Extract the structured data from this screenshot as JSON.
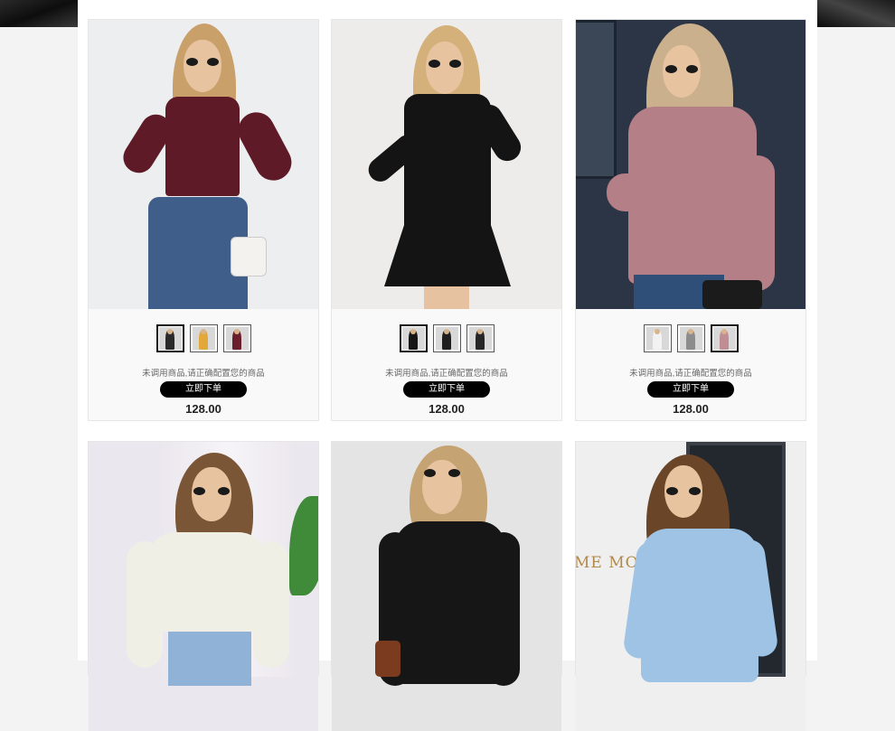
{
  "products": [
    {
      "description": "未调用商品,请正确配置您的商品",
      "button_label": "立即下单",
      "price": "128.00",
      "colors": {
        "top": "#5e1a26",
        "bottom": "#3f5f8a",
        "background": "#eceeef",
        "hair": "#c9a06a"
      },
      "thumbnails": [
        {
          "color": "#2a2a2a",
          "active": true
        },
        {
          "color": "#e2a93a",
          "active": false
        },
        {
          "color": "#6b1e2c",
          "active": false
        }
      ]
    },
    {
      "description": "未调用商品,请正确配置您的商品",
      "button_label": "立即下单",
      "price": "128.00",
      "colors": {
        "top": "#141414",
        "bottom": "#141414",
        "background": "#eeeceb",
        "hair": "#d4b07a"
      },
      "thumbnails": [
        {
          "color": "#161616",
          "active": true
        },
        {
          "color": "#1e1e1e",
          "active": false
        },
        {
          "color": "#262626",
          "active": false
        }
      ]
    },
    {
      "description": "未调用商品,请正确配置您的商品",
      "button_label": "立即下单",
      "price": "128.00",
      "colors": {
        "top": "#b57f87",
        "bottom": "#2f4e78",
        "background": "#2b3545",
        "hair": "#cbb08e"
      },
      "thumbnails": [
        {
          "color": "#f2f2f2",
          "active": false
        },
        {
          "color": "#8c8c8c",
          "active": false
        },
        {
          "color": "#c08d95",
          "active": true
        }
      ]
    },
    {
      "colors": {
        "top": "#efefe6",
        "bottom": "#8fb2d6",
        "background": "#ebe7ee",
        "hair": "#7a5636"
      }
    },
    {
      "colors": {
        "top": "#161616",
        "bottom": "#161616",
        "background": "#e4e4e4",
        "hair": "#c6a372"
      }
    },
    {
      "sign_text": "ME MOI",
      "colors": {
        "top": "#9fc3e4",
        "bottom": "#9fc3e4",
        "background": "#efefef",
        "hair": "#6b4528"
      }
    }
  ]
}
